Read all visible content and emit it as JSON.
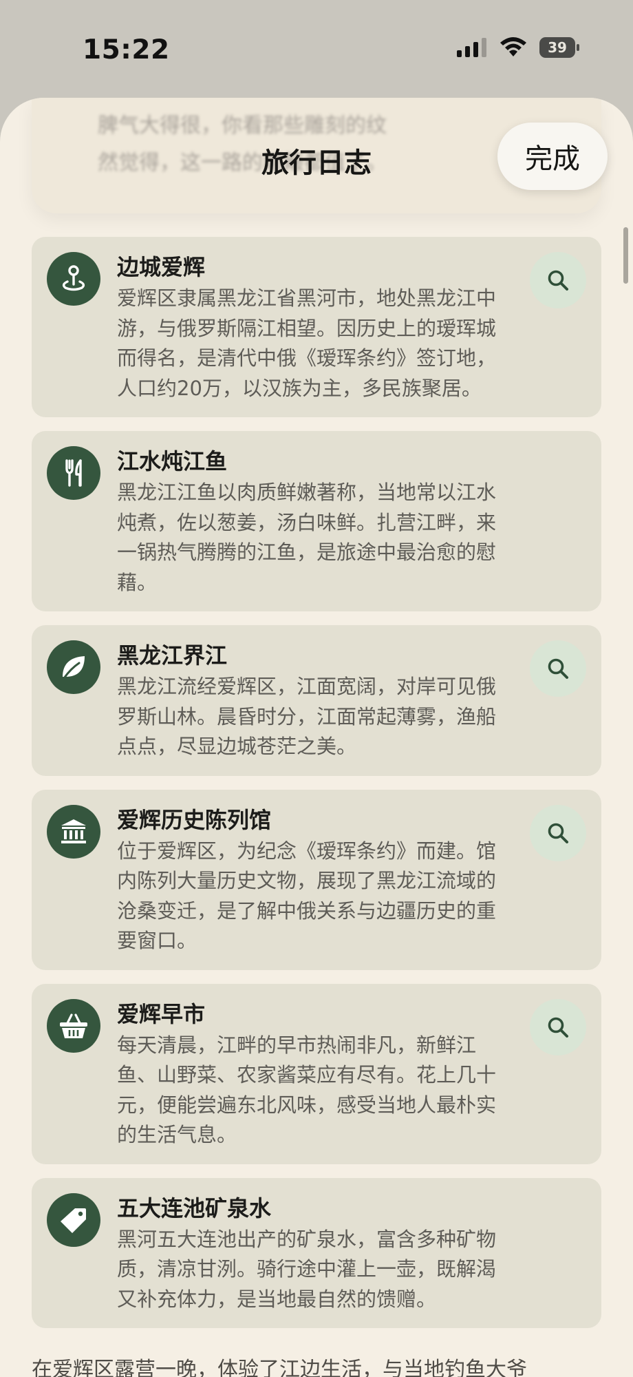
{
  "status_bar": {
    "time": "15:22",
    "battery": "39"
  },
  "header": {
    "title": "旅行日志",
    "done_label": "完成",
    "background_text": "脾气大得很，你看那些雕刻的纹\n然觉得，这一路的颠簸都值了。"
  },
  "entries": [
    {
      "icon": "map-pin-icon",
      "title": "边城爱辉",
      "description": "爱辉区隶属黑龙江省黑河市，地处黑龙江中游，与俄罗斯隔江相望。因历史上的瑷珲城而得名，是清代中俄《瑷珲条约》签订地，人口约20万，以汉族为主，多民族聚居。",
      "has_search": true
    },
    {
      "icon": "fork-knife-icon",
      "title": "江水炖江鱼",
      "description": "黑龙江江鱼以肉质鲜嫩著称，当地常以江水炖煮，佐以葱姜，汤白味鲜。扎营江畔，来一锅热气腾腾的江鱼，是旅途中最治愈的慰藉。",
      "has_search": false
    },
    {
      "icon": "leaf-icon",
      "title": "黑龙江界江",
      "description": "黑龙江流经爱辉区，江面宽阔，对岸可见俄罗斯山林。晨昏时分，江面常起薄雾，渔船点点，尽显边城苍茫之美。",
      "has_search": true
    },
    {
      "icon": "museum-icon",
      "title": "爱辉历史陈列馆",
      "description": "位于爱辉区，为纪念《瑷珲条约》而建。馆内陈列大量历史文物，展现了黑龙江流域的沧桑变迁，是了解中俄关系与边疆历史的重要窗口。",
      "has_search": true
    },
    {
      "icon": "basket-icon",
      "title": "爱辉早市",
      "description": "每天清晨，江畔的早市热闹非凡，新鲜江鱼、山野菜、农家酱菜应有尽有。花上几十元，便能尝遍东北风味，感受当地人最朴实的生活气息。",
      "has_search": true
    },
    {
      "icon": "tag-icon",
      "title": "五大连池矿泉水",
      "description": "黑河五大连池出产的矿泉水，富含多种矿物质，清凉甘洌。骑行途中灌上一壶，既解渴又补充体力，是当地最自然的馈赠。",
      "has_search": false
    }
  ],
  "footer_text": "在爱辉区露营一晚，体验了江边生活，与当地钓鱼大爷"
}
